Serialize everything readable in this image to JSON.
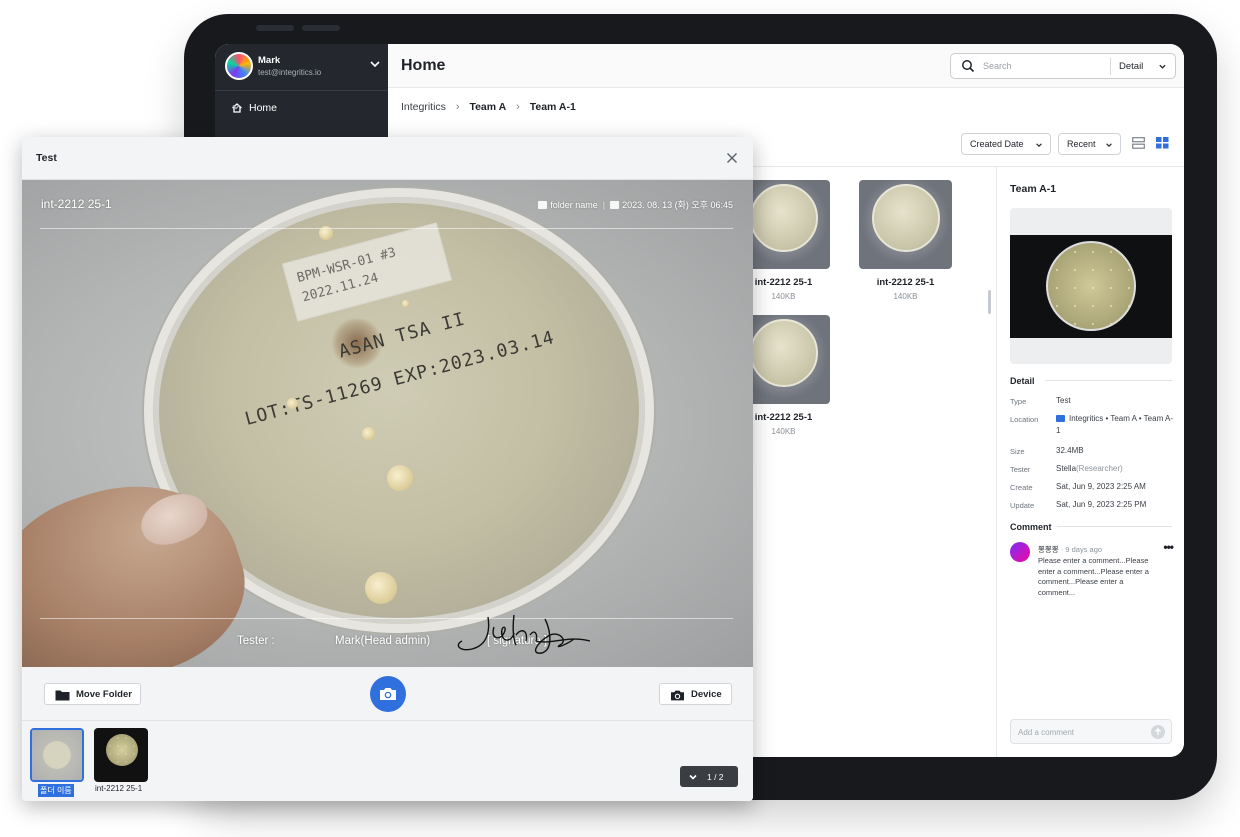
{
  "sidebar": {
    "user_name": "Mark",
    "user_email": "test@integritics.io",
    "nav_home": "Home"
  },
  "header": {
    "title": "Home",
    "search_placeholder": "Search",
    "search_mode": "Detail"
  },
  "breadcrumb": [
    "Integritics",
    "Team A",
    "Team A-1"
  ],
  "sort": {
    "order_by": "Created Date",
    "recency": "Recent"
  },
  "files": [
    {
      "name": "int-2212 25-1",
      "size": "140KB"
    },
    {
      "name": "int-2212 25-1",
      "size": "140KB"
    },
    {
      "name": "int-2212 25-1",
      "size": "140KB"
    }
  ],
  "details": {
    "title": "Team A-1",
    "section": "Detail",
    "labels": {
      "type": "Type",
      "location": "Location",
      "size": "Size",
      "tester": "Tester",
      "create": "Create",
      "update": "Update"
    },
    "type": "Test",
    "location": "Integritics • Team A • Team A-1",
    "size": "32.4MB",
    "tester_name": "Stella",
    "tester_role": "(Researcher)",
    "create": "Sat, Jun 9, 2023 2:25 AM",
    "update": "Sat, Jun 9, 2023 2:25 PM"
  },
  "comment": {
    "section": "Comment",
    "author": "뽕뽕뽕",
    "time": "9 days ago",
    "text": "Please enter a comment...Please enter a comment...Please enter a comment...Please enter a comment...",
    "input_placeholder": "Add a comment"
  },
  "modal": {
    "title": "Test",
    "photo_title": "int-2212 25-1",
    "folder_name": "folder name",
    "datetime": "2023. 08. 13 (화) 오후 06:45",
    "tester_label": "Tester :",
    "tester_value": "Mark(Head admin)",
    "signature_label": "[ signature ]",
    "plate_label_1": "BPM-WSR-01 #3",
    "plate_label_2": "2022.11.24",
    "plate_stamp_1": "ASAN TSA II",
    "plate_stamp_2": "LOT:TS-11269 EXP:2023.03.14",
    "move_folder": "Move Folder",
    "device": "Device",
    "strip": [
      {
        "label": "폴더 이름"
      },
      {
        "label": "int-2212 25-1"
      }
    ],
    "pager": "1 / 2"
  },
  "colors": {
    "accent": "#2f6fde",
    "sidebar": "#24282e"
  }
}
